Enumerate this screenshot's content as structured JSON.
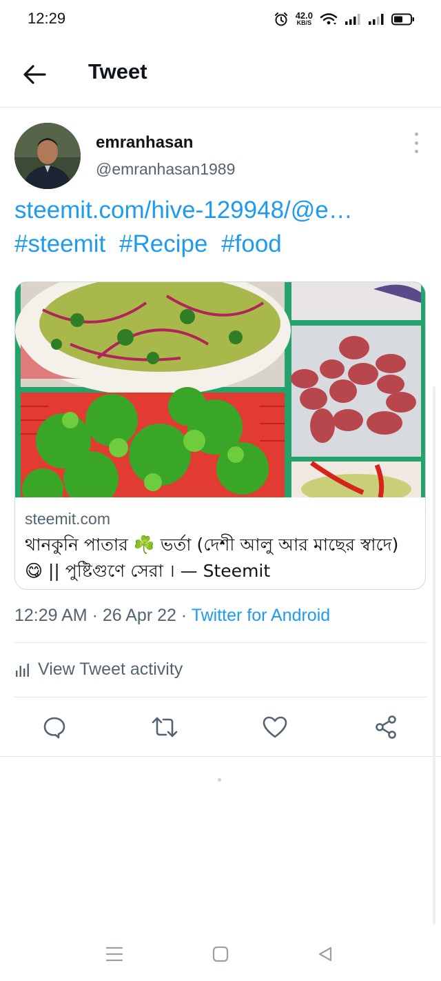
{
  "status_bar": {
    "time": "12:29",
    "net_speed_value": "42.0",
    "net_speed_unit": "KB/S",
    "icons": [
      "alarm-icon",
      "wifi-icon",
      "signal-icon",
      "signal-icon",
      "battery-icon"
    ]
  },
  "header": {
    "back_icon": "arrow-left-icon",
    "title": "Tweet"
  },
  "tweet": {
    "author": {
      "display_name": "emranhasan",
      "handle": "@emranhasan1989"
    },
    "link_text": "steemit.com/hive-129948/@e…",
    "hashtags": [
      "#steemit",
      "#Recipe",
      "#food"
    ],
    "card": {
      "domain": "steemit.com",
      "title": "থানকুনি পাতার ☘️ ভর্তা (দেশী আলু আর মাছের স্বাদে) 😋 || পুষ্টিগুণে সেরা । — Steemit"
    },
    "meta": {
      "time": "12:29 AM",
      "separator": "·",
      "date": "26 Apr 22",
      "source": "Twitter for Android"
    },
    "activity_label": "View Tweet activity"
  },
  "actions": [
    "reply-icon",
    "retweet-icon",
    "like-icon",
    "share-icon"
  ],
  "colors": {
    "link": "#1d9bf0",
    "secondary_text": "#536471",
    "primary_text": "#0f1419",
    "divider": "#dfe3e6"
  }
}
